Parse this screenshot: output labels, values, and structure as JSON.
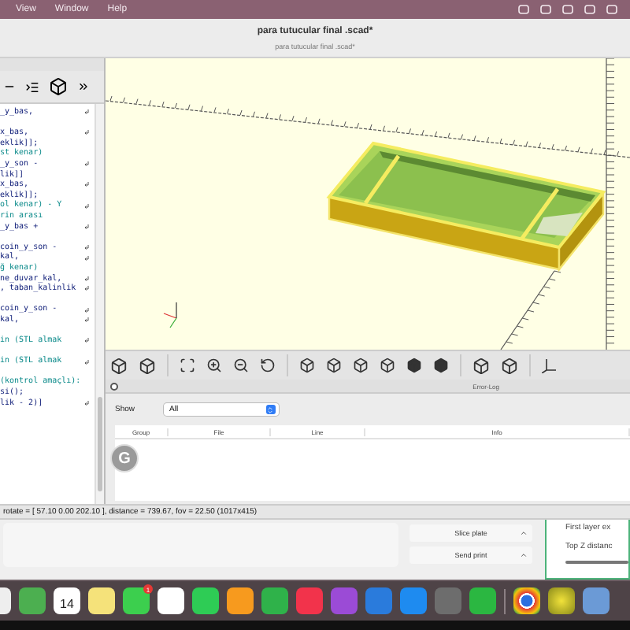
{
  "menu_bar": {
    "items": [
      "View",
      "Window",
      "Help"
    ]
  },
  "window": {
    "title": "para tutucular final .scad*",
    "subtitle": "para tutucular final .scad*"
  },
  "editor": {
    "blocks": [
      [
        {
          "text": "_y_bas,",
          "kind": "code",
          "wrapped": true
        }
      ],
      [
        {
          "text": "x_bas,",
          "kind": "code",
          "wrapped": true
        },
        {
          "text": "eklik]];",
          "kind": "code",
          "wrapped": false
        },
        {
          "text": "st kenar)",
          "kind": "comment",
          "wrapped": false
        },
        {
          "text": "_y_son -",
          "kind": "code",
          "wrapped": true
        },
        {
          "text": "lik]]",
          "kind": "code",
          "wrapped": false
        },
        {
          "text": "x_bas,",
          "kind": "code",
          "wrapped": true
        },
        {
          "text": "eklik]];",
          "kind": "code",
          "wrapped": false
        },
        {
          "text": "ol kenar) - Y",
          "kind": "comment",
          "wrapped": true
        },
        {
          "text": "rin arası",
          "kind": "comment",
          "wrapped": false
        },
        {
          "text": "_y_bas +",
          "kind": "code",
          "wrapped": true
        }
      ],
      [
        {
          "text": "coin_y_son -",
          "kind": "code",
          "wrapped": true
        },
        {
          "text": "kal,",
          "kind": "code",
          "wrapped": true
        },
        {
          "text": "ğ kenar)",
          "kind": "comment",
          "wrapped": false
        },
        {
          "text": "ne_duvar_kal,",
          "kind": "code",
          "wrapped": true
        },
        {
          "text": ", taban_kalinlik",
          "kind": "code",
          "wrapped": true
        }
      ],
      [
        {
          "text": "coin_y_son -",
          "kind": "code",
          "wrapped": true
        },
        {
          "text": "kal,",
          "kind": "code",
          "wrapped": true
        }
      ],
      [
        {
          "text": "in (STL almak",
          "kind": "comment",
          "wrapped": true
        }
      ],
      [
        {
          "text": "in (STL almak",
          "kind": "comment",
          "wrapped": true
        }
      ],
      [
        {
          "text": "(kontrol amaçlı):",
          "kind": "comment",
          "wrapped": false
        },
        {
          "text": "si();",
          "kind": "code",
          "wrapped": false
        },
        {
          "text": "lik - 2)]",
          "kind": "code",
          "wrapped": true
        }
      ]
    ]
  },
  "error_log": {
    "title": "Error-Log",
    "show_label": "Show",
    "filter": "All",
    "columns": [
      "Group",
      "File",
      "Line",
      "Info"
    ]
  },
  "grammar_badge": "G",
  "status_bar": "rotate = [ 57.10 0.00 202.10 ], distance = 739.67, fov = 22.50 (1017x415)",
  "slicer": {
    "buttons": [
      "Slice plate",
      "Send print"
    ],
    "settings": [
      "First layer ex",
      "Top Z distanc"
    ]
  },
  "dock": {
    "calendar_day": "14",
    "messages_badge": "1"
  }
}
